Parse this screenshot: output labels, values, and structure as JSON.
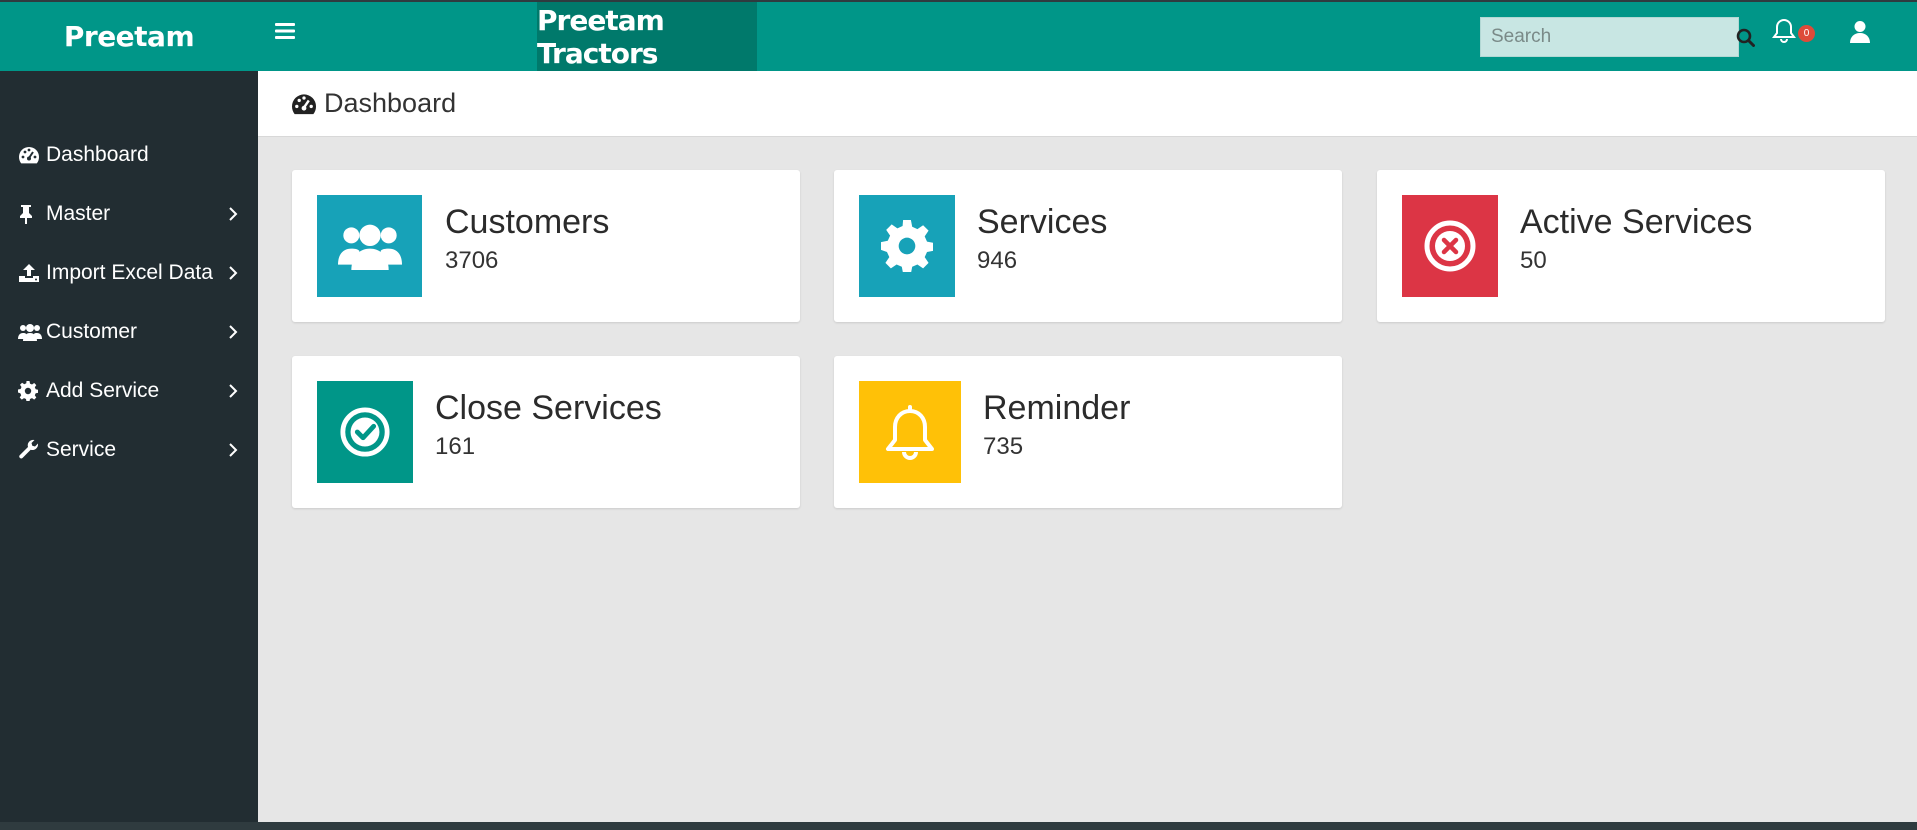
{
  "sidebar": {
    "brand": "Preetam",
    "items": [
      {
        "label": "Dashboard",
        "icon": "dashboard-icon"
      },
      {
        "label": "Master",
        "icon": "thumbtack-icon"
      },
      {
        "label": "Import Excel Data",
        "icon": "upload-icon"
      },
      {
        "label": "Customer",
        "icon": "users-icon"
      },
      {
        "label": "Add Service",
        "icon": "gear-icon"
      },
      {
        "label": "Service",
        "icon": "wrench-icon"
      }
    ]
  },
  "header": {
    "title": "Preetam Tractors",
    "search_placeholder": "Search",
    "notification_count": "0"
  },
  "page": {
    "title": "Dashboard"
  },
  "cards": [
    {
      "title": "Customers",
      "value": "3706",
      "icon": "users-icon",
      "color": "#17a2b8"
    },
    {
      "title": "Services",
      "value": "946",
      "icon": "gear-icon",
      "color": "#17a2b8"
    },
    {
      "title": "Active Services",
      "value": "50",
      "icon": "times-circle-icon",
      "color": "#dc3545"
    },
    {
      "title": "Close Services",
      "value": "161",
      "icon": "check-circle-icon",
      "color": "#009688"
    },
    {
      "title": "Reminder",
      "value": "735",
      "icon": "bell-icon",
      "color": "#ffc107"
    }
  ],
  "colors": {
    "brand": "#009688",
    "brand_dark": "#00796b",
    "sidebar_bg": "#222d32",
    "content_bg": "#e6e6e6"
  }
}
